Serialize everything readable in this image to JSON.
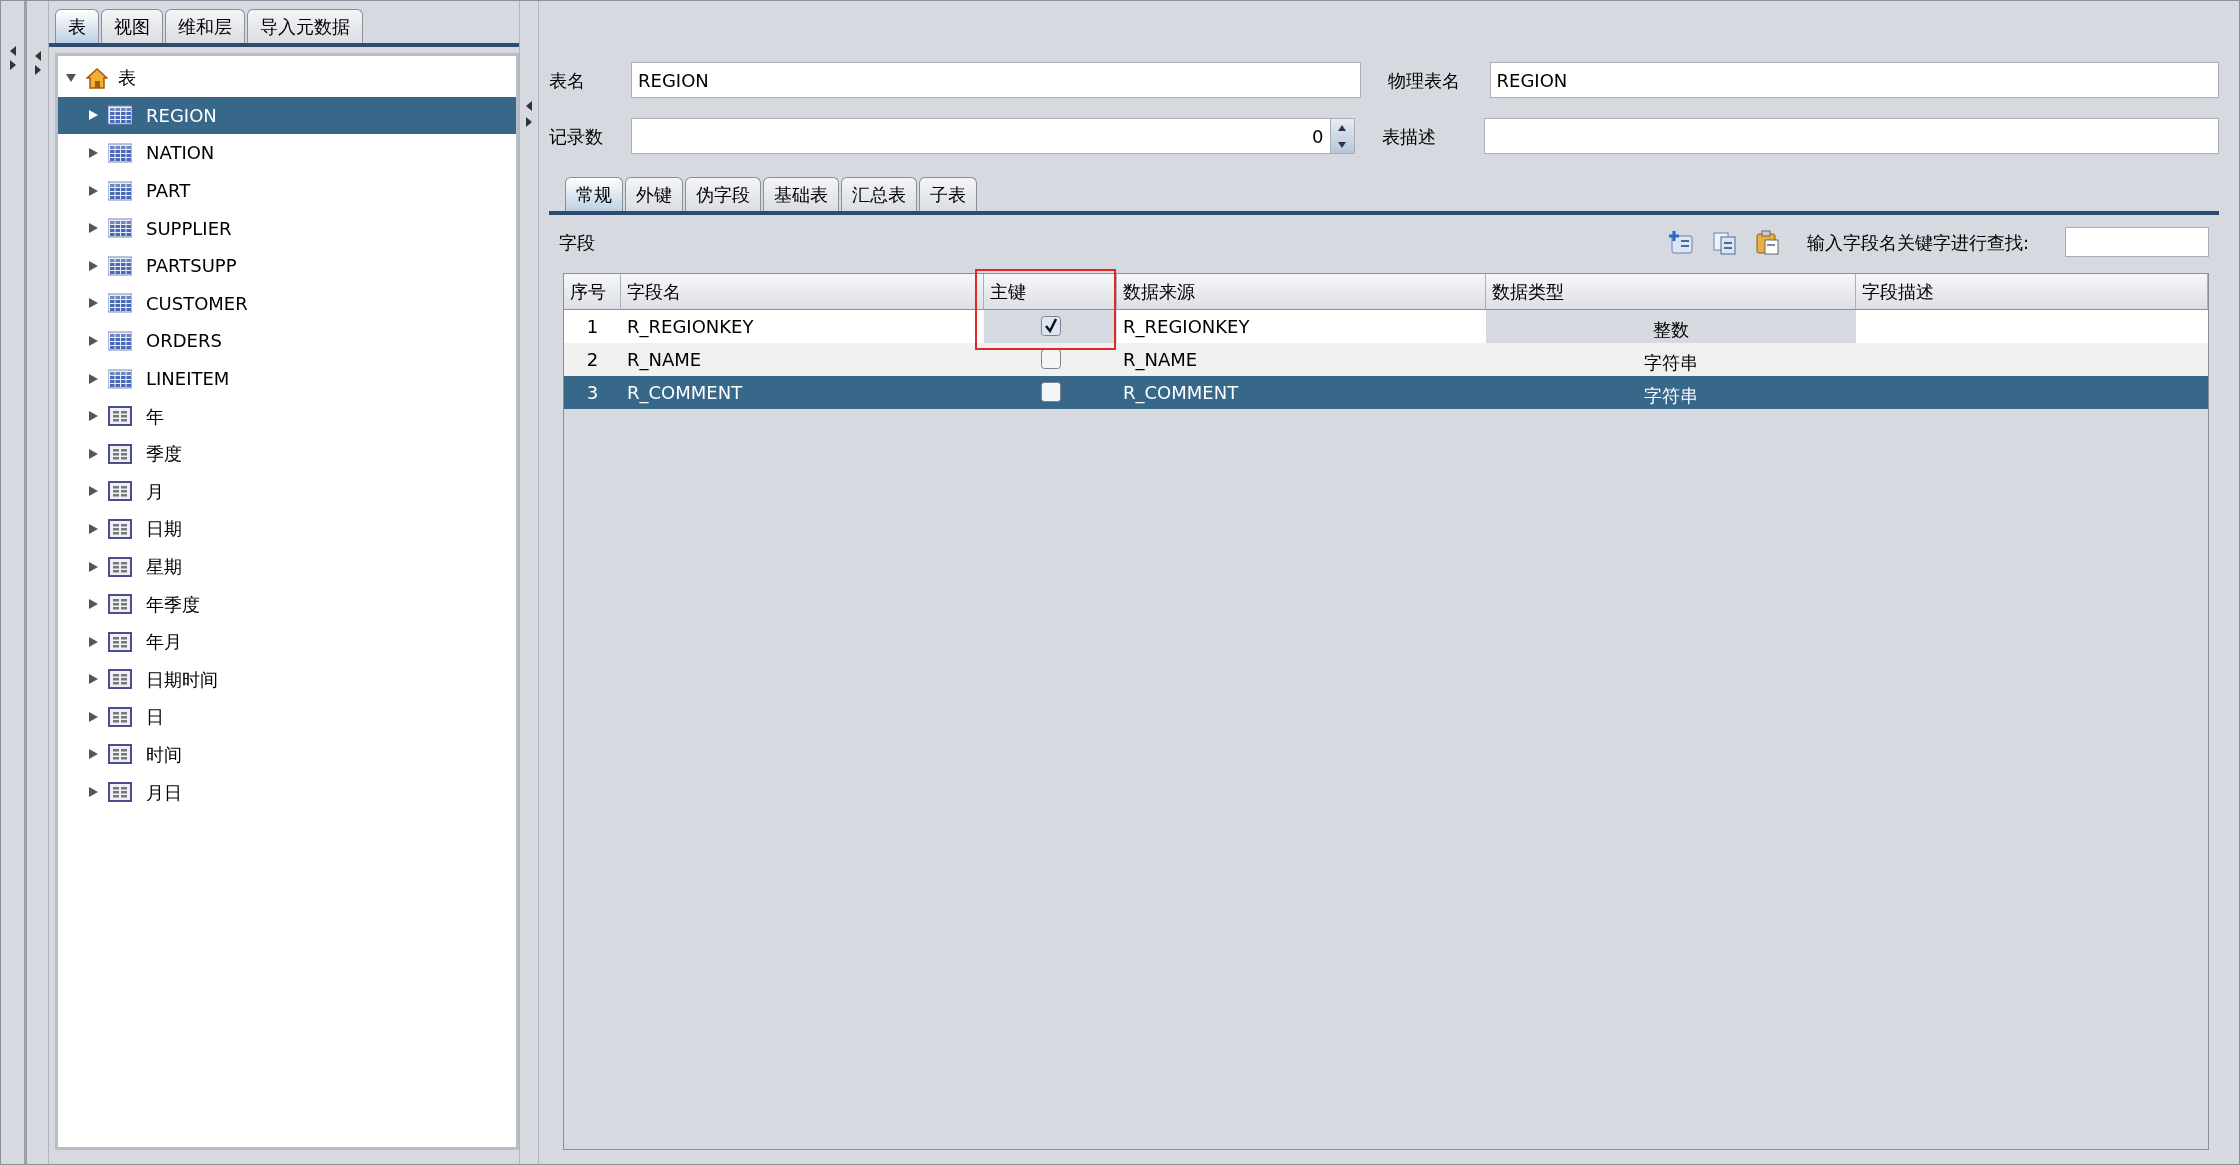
{
  "main_tabs": [
    {
      "label": "表",
      "selected": true
    },
    {
      "label": "视图",
      "selected": false
    },
    {
      "label": "维和层",
      "selected": false
    },
    {
      "label": "导入元数据",
      "selected": false
    }
  ],
  "tree": {
    "label": "表",
    "expanded": true,
    "children": [
      {
        "label": "REGION",
        "kind": "table",
        "selected": true,
        "expanded": false
      },
      {
        "label": "NATION",
        "kind": "table",
        "selected": false,
        "expanded": false
      },
      {
        "label": "PART",
        "kind": "table",
        "selected": false,
        "expanded": false
      },
      {
        "label": "SUPPLIER",
        "kind": "table",
        "selected": false,
        "expanded": false
      },
      {
        "label": "PARTSUPP",
        "kind": "table",
        "selected": false,
        "expanded": false
      },
      {
        "label": "CUSTOMER",
        "kind": "table",
        "selected": false,
        "expanded": false
      },
      {
        "label": "ORDERS",
        "kind": "table",
        "selected": false,
        "expanded": false
      },
      {
        "label": "LINEITEM",
        "kind": "table",
        "selected": false,
        "expanded": false
      },
      {
        "label": "年",
        "kind": "dimension",
        "selected": false,
        "expanded": false
      },
      {
        "label": "季度",
        "kind": "dimension",
        "selected": false,
        "expanded": false
      },
      {
        "label": "月",
        "kind": "dimension",
        "selected": false,
        "expanded": false
      },
      {
        "label": "日期",
        "kind": "dimension",
        "selected": false,
        "expanded": false
      },
      {
        "label": "星期",
        "kind": "dimension",
        "selected": false,
        "expanded": false
      },
      {
        "label": "年季度",
        "kind": "dimension",
        "selected": false,
        "expanded": false
      },
      {
        "label": "年月",
        "kind": "dimension",
        "selected": false,
        "expanded": false
      },
      {
        "label": "日期时间",
        "kind": "dimension",
        "selected": false,
        "expanded": false
      },
      {
        "label": "日",
        "kind": "dimension",
        "selected": false,
        "expanded": false
      },
      {
        "label": "时间",
        "kind": "dimension",
        "selected": false,
        "expanded": false
      },
      {
        "label": "月日",
        "kind": "dimension",
        "selected": false,
        "expanded": false
      }
    ]
  },
  "form": {
    "table_name": {
      "label": "表名",
      "value": "REGION"
    },
    "physical_name": {
      "label": "物理表名",
      "value": "REGION"
    },
    "record_count": {
      "label": "记录数",
      "value": "0"
    },
    "description": {
      "label": "表描述"
    }
  },
  "sub_tabs": [
    {
      "label": "常规",
      "selected": true
    },
    {
      "label": "外键",
      "selected": false
    },
    {
      "label": "伪字段",
      "selected": false
    },
    {
      "label": "基础表",
      "selected": false
    },
    {
      "label": "汇总表",
      "selected": false
    },
    {
      "label": "子表",
      "selected": false
    }
  ],
  "fields_section": {
    "label": "字段",
    "search_label": "输入字段名关键字进行查找:"
  },
  "table": {
    "columns": [
      {
        "label": "序号",
        "highlighted": false
      },
      {
        "label": "字段名",
        "highlighted": false
      },
      {
        "label": "主键",
        "highlighted": true
      },
      {
        "label": "数据来源",
        "highlighted": false
      },
      {
        "label": "数据类型",
        "highlighted": false
      },
      {
        "label": "字段描述",
        "highlighted": false
      }
    ],
    "rows": [
      {
        "index": "1",
        "name": "R_REGIONKEY",
        "primary_key": true,
        "source": "R_REGIONKEY",
        "type": "整数",
        "selected": false,
        "current": true
      },
      {
        "index": "2",
        "name": "R_NAME",
        "primary_key": false,
        "source": "R_NAME",
        "type": "字符串",
        "selected": false,
        "current": false
      },
      {
        "index": "3",
        "name": "R_COMMENT",
        "primary_key": false,
        "source": "R_COMMENT",
        "type": "字符串",
        "selected": true,
        "current": false
      }
    ]
  }
}
